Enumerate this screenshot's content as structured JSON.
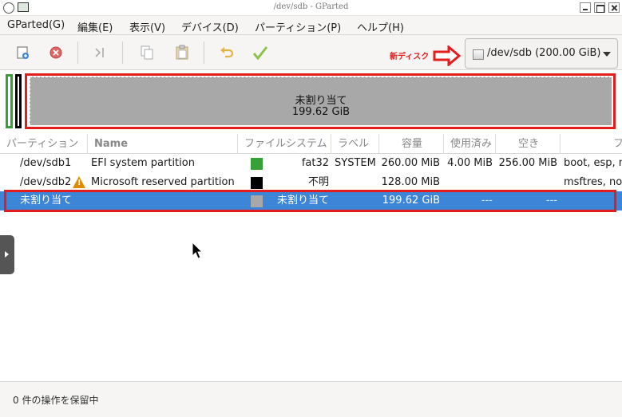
{
  "window": {
    "title": "/dev/sdb - GParted"
  },
  "menu": [
    "GParted(G)",
    "編集(E)",
    "表示(V)",
    "デバイス(D)",
    "パーティション(P)",
    "ヘルプ(H)"
  ],
  "toolbar": {
    "buttons": [
      "new-partition",
      "delete-partition",
      "resize-move",
      "copy",
      "paste",
      "undo",
      "apply"
    ],
    "device_combo": "/dev/sdb (200.00 GiB)",
    "annotation": "新ディスク"
  },
  "disk_map": {
    "unallocated_label": "未割り当て",
    "unallocated_size": "199.62 GiB"
  },
  "columns": [
    "パーティション",
    "Name",
    "ファイルシステム",
    "ラベル",
    "容量",
    "使用済み",
    "空き",
    "フ"
  ],
  "rows": [
    {
      "partition": "/dev/sdb1",
      "name": "EFI system partition",
      "filesystem": "fat32",
      "label": "SYSTEM",
      "size": "260.00 MiB",
      "used": "4.00 MiB",
      "unused": "256.00 MiB",
      "flags": "boot, esp, n",
      "fs_color": "#37a137"
    },
    {
      "partition": "/dev/sdb2",
      "name": "Microsoft reserved partition",
      "filesystem": "不明",
      "label": "",
      "size": "128.00 MiB",
      "used": "",
      "unused": "",
      "flags": "msftres, no",
      "fs_color": "#000000",
      "warning": true
    },
    {
      "partition": "未割り当て",
      "name": "",
      "filesystem": "未割り当て",
      "label": "",
      "size": "199.62 GiB",
      "used": "---",
      "unused": "---",
      "flags": "",
      "fs_color": "#a8a8a8",
      "selected": true
    }
  ],
  "status": {
    "pending": "0 件の操作を保留中"
  },
  "colors": {
    "selection": "#3d86d7",
    "highlight_red": "#e31c1c"
  }
}
